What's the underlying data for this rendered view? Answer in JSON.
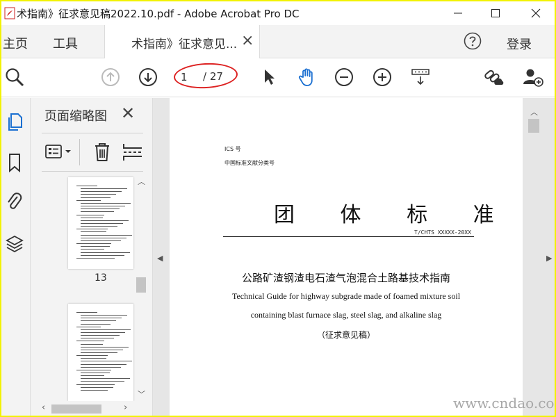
{
  "window": {
    "title": "术指南》征求意见稿2022.10.pdf - Adobe Acrobat Pro DC"
  },
  "tabs": {
    "home": "主页",
    "tools": "工具",
    "document_tab": "术指南》征求意见...",
    "help_icon": "help-icon",
    "login": "登录"
  },
  "toolbar": {
    "current_page": "1",
    "total_pages": "/ 27",
    "icons": [
      "zoom-icon",
      "previous-page-icon",
      "next-page-icon",
      "select-cursor-icon",
      "hand-tool-icon",
      "zoom-out-icon",
      "zoom-in-icon",
      "scroll-mode-icon",
      "share-link-icon",
      "add-user-icon"
    ]
  },
  "thumbnail_panel": {
    "title": "页面缩略图",
    "thumbnails": [
      {
        "label": "13"
      },
      {
        "label": ""
      }
    ]
  },
  "document": {
    "ics": "ICS 号",
    "classification": "中国标准文献分类号",
    "big_title": "团 体 标 准",
    "standard_code": "T/CHTS  XXXXX-20XX",
    "title_cn": "公路矿渣钢渣电石渣气泡混合土路基技术指南",
    "title_en_1": "Technical Guide for highway subgrade made of foamed mixture soil",
    "title_en_2": "containing blast furnace slag, steel slag, and alkaline slag",
    "draft_label": "（征求意见稿）"
  },
  "overlay": {
    "watermark": "www.cndao.com",
    "highlight_color": "#dd2222",
    "border_color": "#f2f200"
  }
}
